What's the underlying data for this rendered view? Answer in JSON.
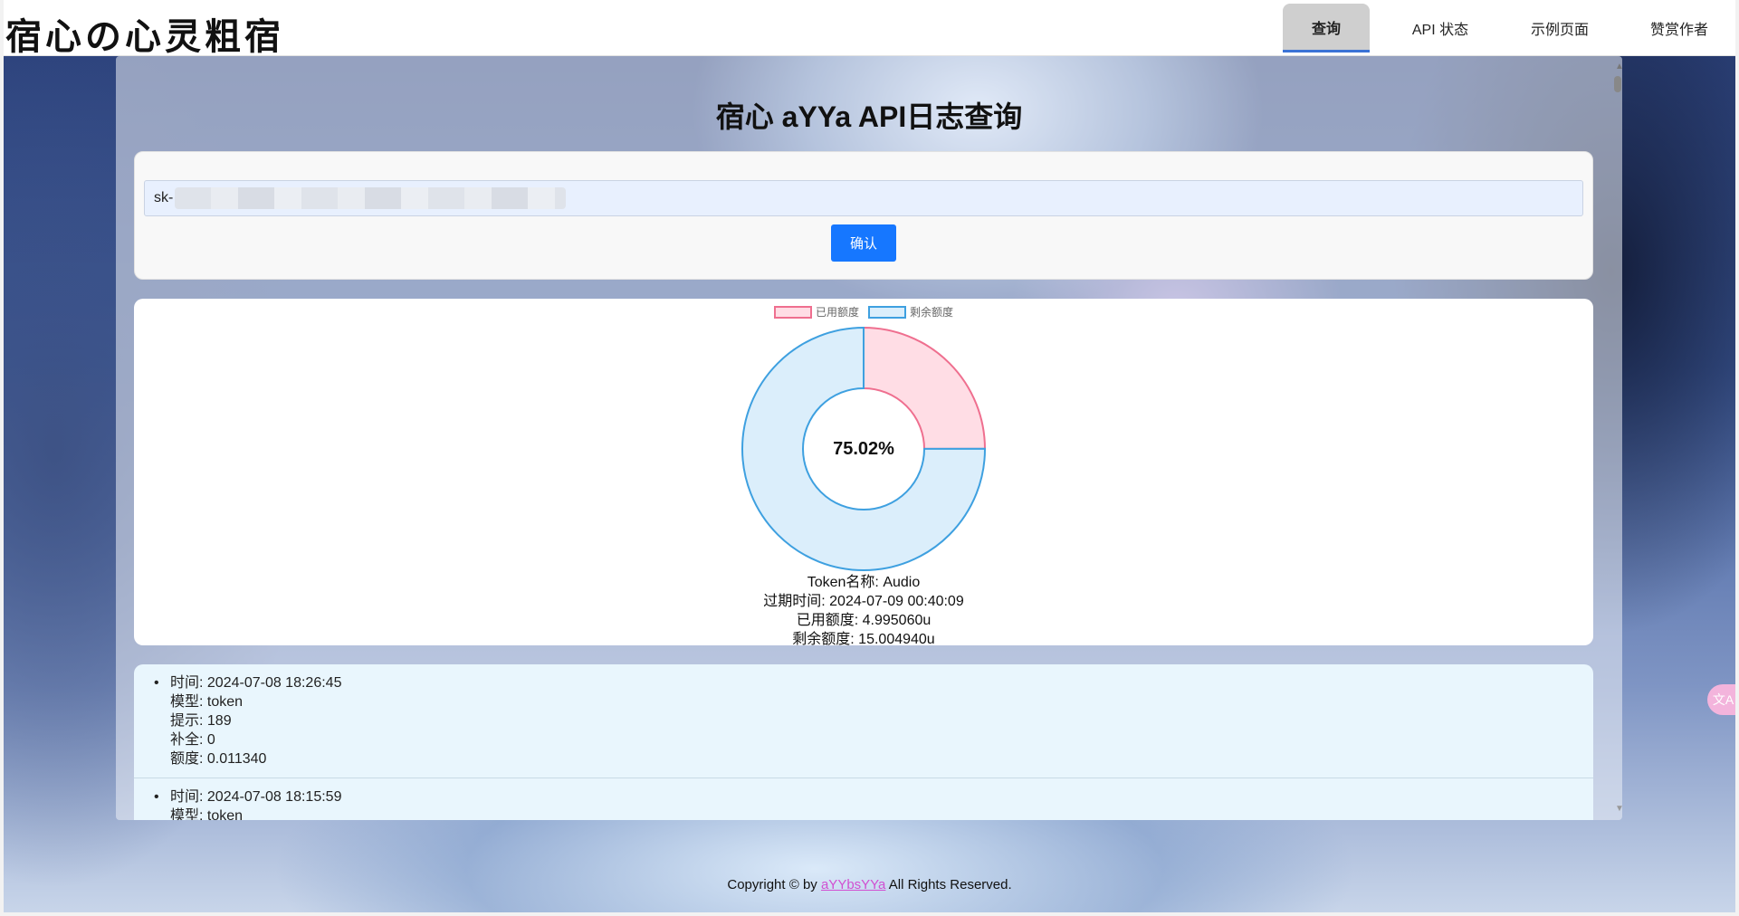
{
  "header": {
    "logo_text": "宿心の心灵粗宿",
    "nav": [
      {
        "label": "查询",
        "active": true
      },
      {
        "label": "API 状态",
        "active": false
      },
      {
        "label": "示例页面",
        "active": false
      },
      {
        "label": "赞赏作者",
        "active": false
      }
    ]
  },
  "main": {
    "title": "宿心 aYYa API日志查询",
    "key_input_value": "sk-",
    "confirm_label": "确认"
  },
  "chart_data": {
    "type": "pie",
    "categories": [
      "已用额度",
      "剩余额度"
    ],
    "values": [
      4.99506,
      15.00494
    ],
    "center_label": "75.02%",
    "colors": [
      "#ef6f8f",
      "#3ea0e0"
    ],
    "fill_colors": [
      "#ffdde5",
      "#dbeefb"
    ],
    "legend_position": "top"
  },
  "token_info": {
    "name": "Token名称: Audio",
    "expire": "过期时间: 2024-07-09 00:40:09",
    "used": "已用额度: 4.995060u",
    "remaining": "剩余额度: 15.004940u"
  },
  "logs": [
    {
      "time": "时间: 2024-07-08 18:26:45",
      "model": "模型: token",
      "prompt": "提示: 189",
      "completion": "补全: 0",
      "quota": "额度: 0.011340"
    },
    {
      "time": "时间: 2024-07-08 18:15:59",
      "model": "模型: token",
      "prompt": "",
      "completion": "",
      "quota": ""
    }
  ],
  "footer": {
    "prefix": "Copyright © by",
    "link": "aYYbsYYa",
    "suffix": "All Rights Reserved."
  },
  "icons": {
    "translate": "translate-icon"
  }
}
